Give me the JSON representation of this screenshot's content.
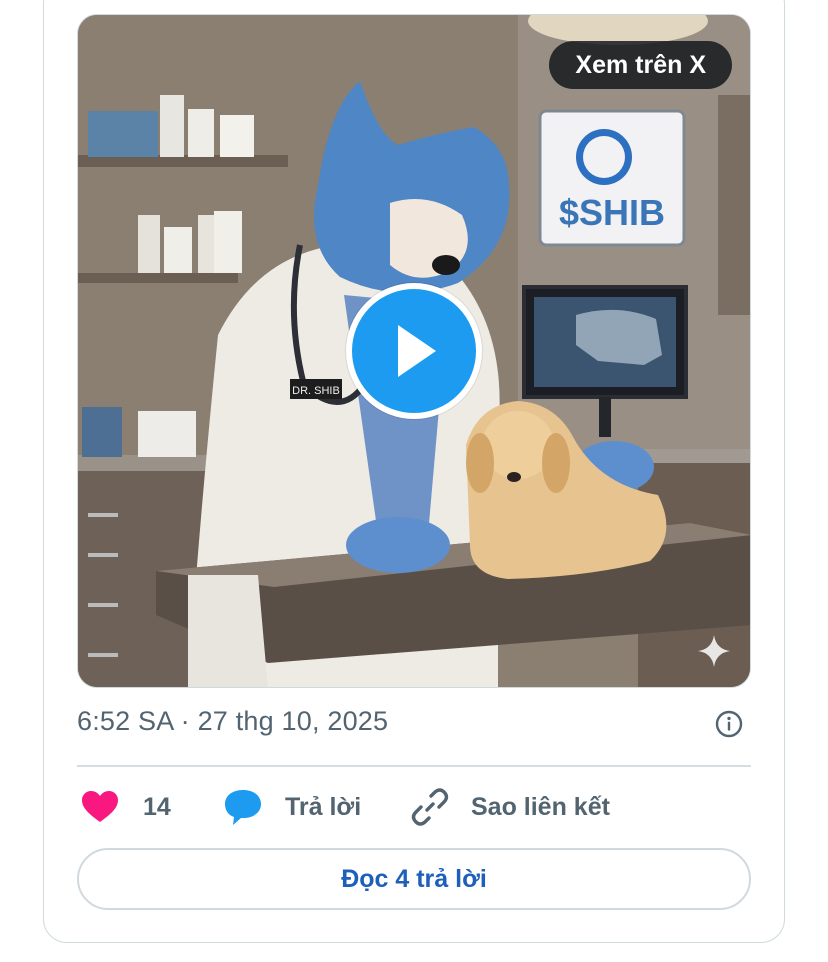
{
  "media": {
    "view_on_x_label": "Xem trên X",
    "sign_text": "$SHIB",
    "badge_text": "DR. SHIB"
  },
  "meta": {
    "timestamp": "6:52 SA · 27 thg 10, 2025"
  },
  "actions": {
    "like_count": "14",
    "reply_label": "Trả lời",
    "copy_link_label": "Sao liên kết"
  },
  "read_replies_label": "Đọc 4 trả lời",
  "colors": {
    "like": "#f91880",
    "reply_bubble": "#1d9bf0",
    "play": "#1d9bf0",
    "link_text": "#1d5fb9"
  }
}
